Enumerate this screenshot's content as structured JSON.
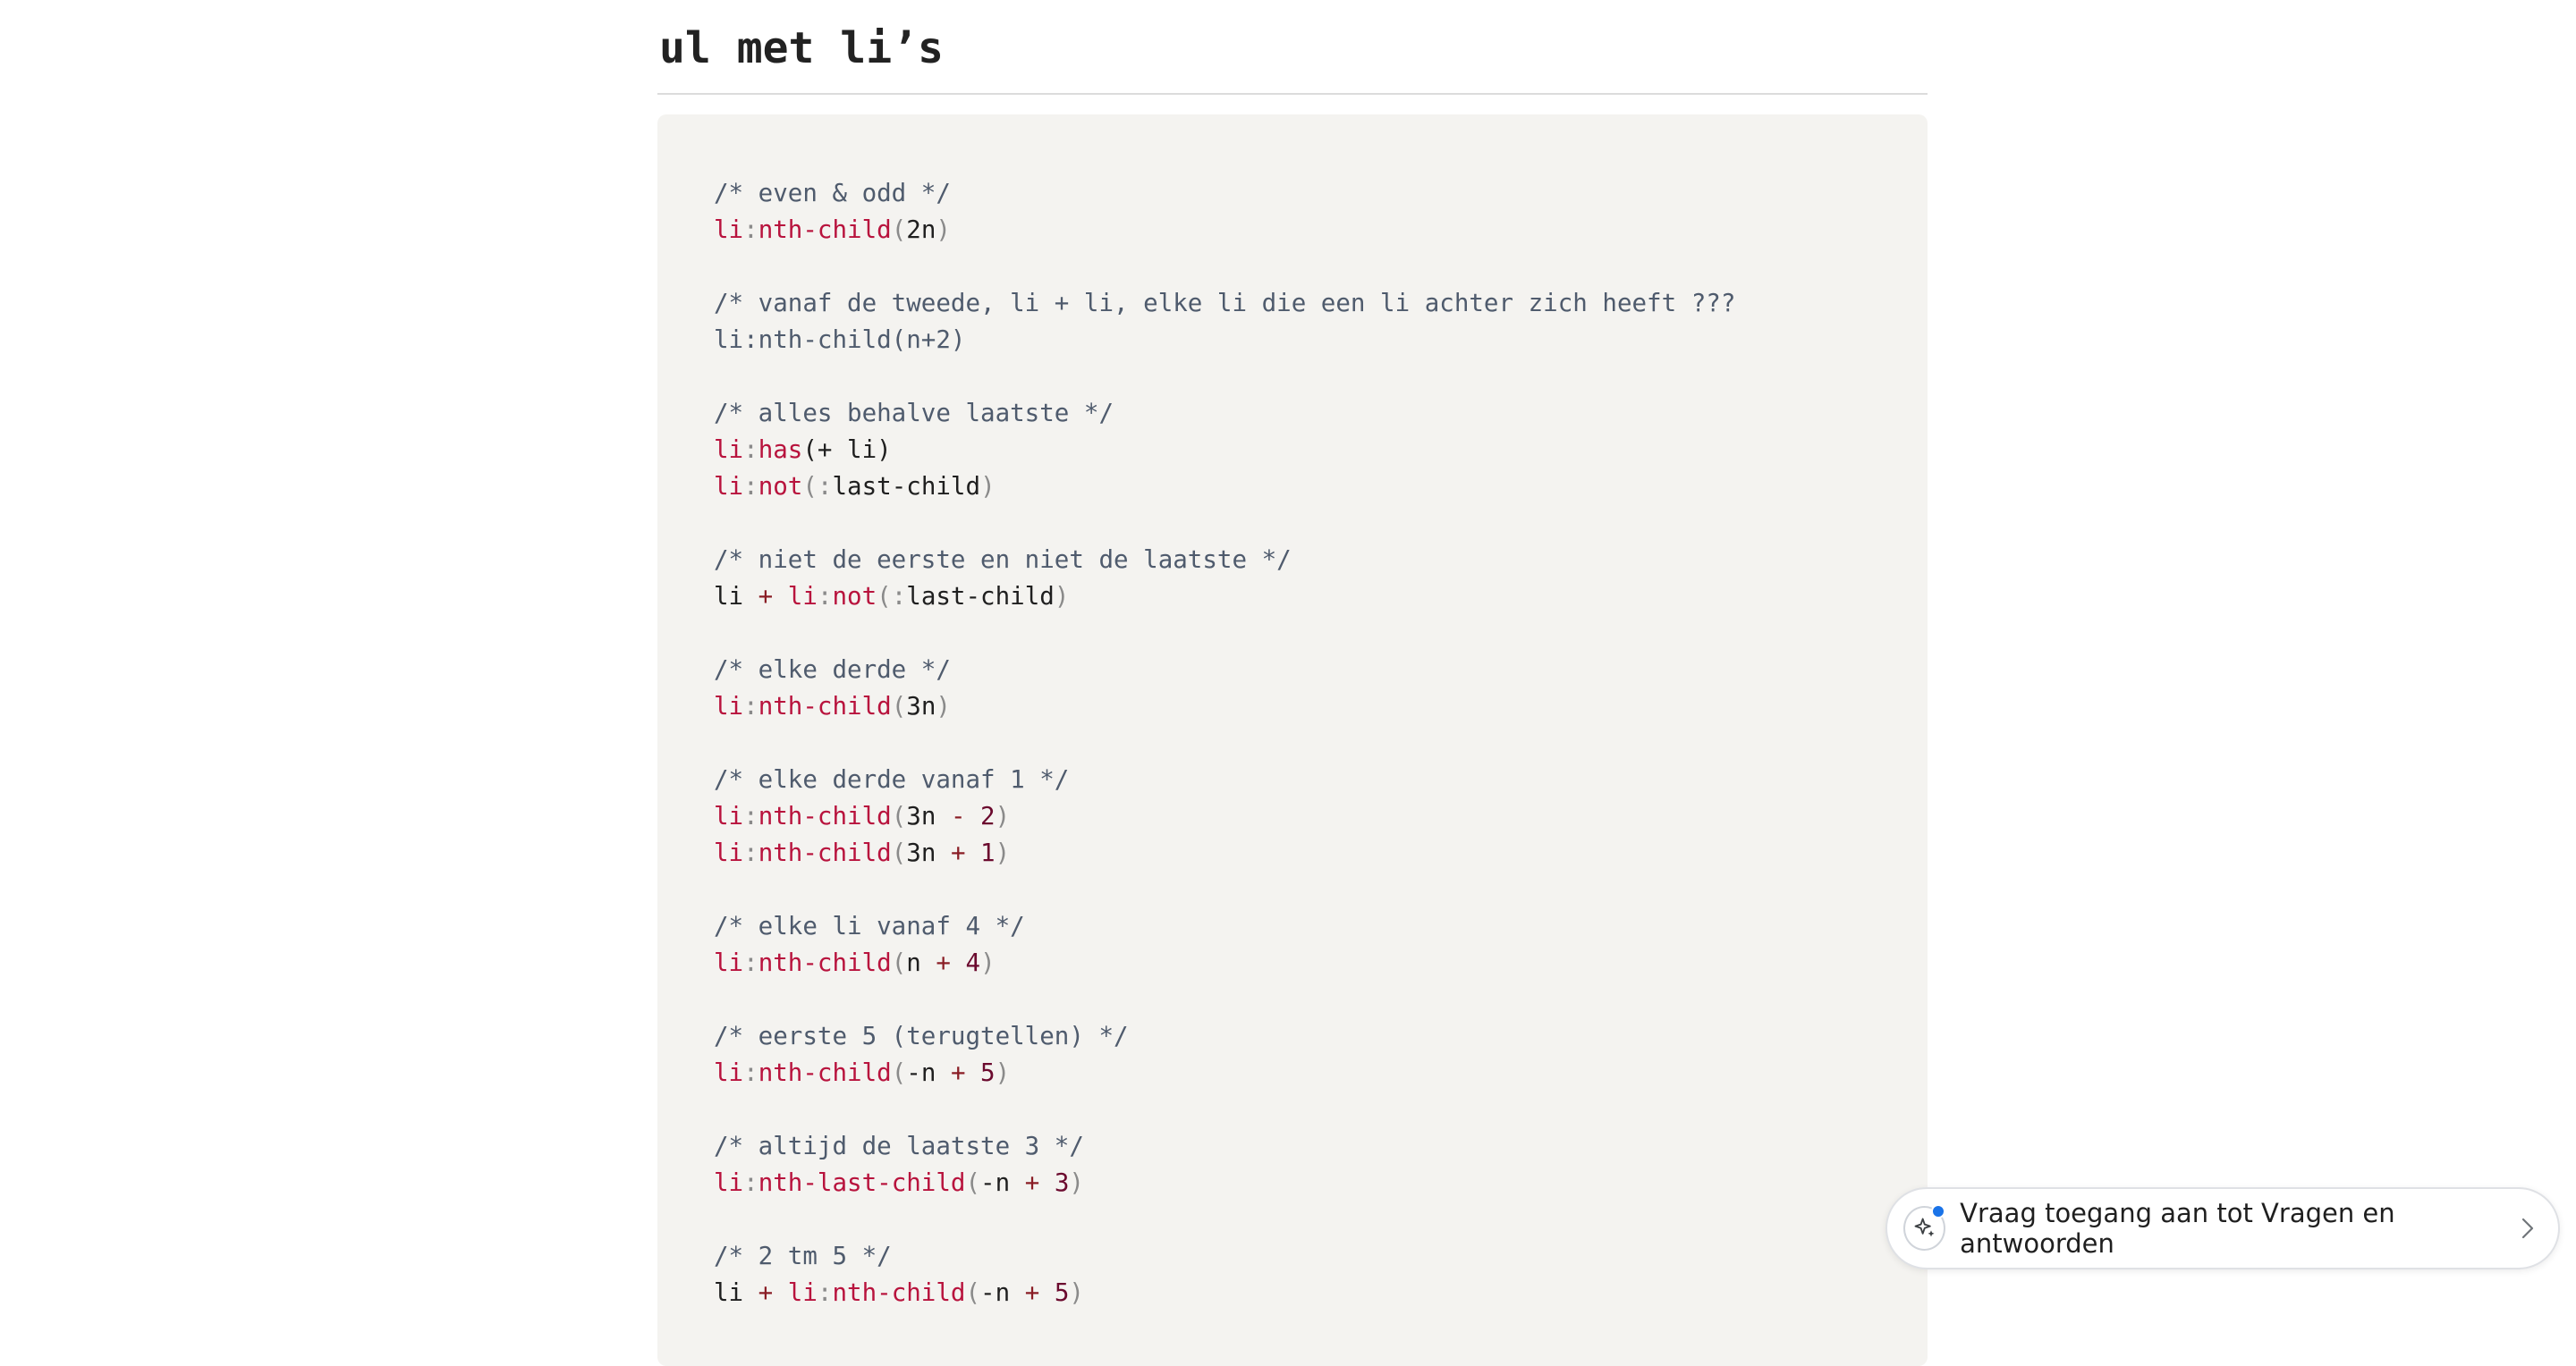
{
  "page": {
    "heading": "ul met li’s"
  },
  "code": {
    "lines": [
      [
        {
          "t": "/* even & odd */",
          "c": "cm"
        }
      ],
      [
        {
          "t": "li",
          "c": "sel"
        },
        {
          "t": ":",
          "c": "pn"
        },
        {
          "t": "nth-child",
          "c": "sel"
        },
        {
          "t": "(",
          "c": "pn"
        },
        {
          "t": "2n",
          "c": "pl"
        },
        {
          "t": ")",
          "c": "pn"
        }
      ],
      [],
      [
        {
          "t": "/* vanaf de tweede, li + li, elke li die een li achter zich heeft ???",
          "c": "cm"
        }
      ],
      [
        {
          "t": "li:nth-child(n+2)",
          "c": "cm"
        }
      ],
      [],
      [
        {
          "t": "/* alles behalve laatste */",
          "c": "cm"
        }
      ],
      [
        {
          "t": "li",
          "c": "sel"
        },
        {
          "t": ":",
          "c": "pn"
        },
        {
          "t": "has",
          "c": "sel"
        },
        {
          "t": "(+ li)",
          "c": "pl"
        }
      ],
      [
        {
          "t": "li",
          "c": "sel"
        },
        {
          "t": ":",
          "c": "pn"
        },
        {
          "t": "not",
          "c": "sel"
        },
        {
          "t": "(",
          "c": "pn"
        },
        {
          "t": ":",
          "c": "pn"
        },
        {
          "t": "last-child",
          "c": "pl"
        },
        {
          "t": ")",
          "c": "pn"
        }
      ],
      [],
      [
        {
          "t": "/* niet de eerste en niet de laatste */",
          "c": "cm"
        }
      ],
      [
        {
          "t": "li ",
          "c": "pl"
        },
        {
          "t": "+",
          "c": "op"
        },
        {
          "t": " li",
          "c": "sel"
        },
        {
          "t": ":",
          "c": "pn"
        },
        {
          "t": "not",
          "c": "sel"
        },
        {
          "t": "(",
          "c": "pn"
        },
        {
          "t": ":",
          "c": "pn"
        },
        {
          "t": "last-child",
          "c": "pl"
        },
        {
          "t": ")",
          "c": "pn"
        }
      ],
      [],
      [
        {
          "t": "/* elke derde */",
          "c": "cm"
        }
      ],
      [
        {
          "t": "li",
          "c": "sel"
        },
        {
          "t": ":",
          "c": "pn"
        },
        {
          "t": "nth-child",
          "c": "sel"
        },
        {
          "t": "(",
          "c": "pn"
        },
        {
          "t": "3n",
          "c": "pl"
        },
        {
          "t": ")",
          "c": "pn"
        }
      ],
      [],
      [
        {
          "t": "/* elke derde vanaf 1 */",
          "c": "cm"
        }
      ],
      [
        {
          "t": "li",
          "c": "sel"
        },
        {
          "t": ":",
          "c": "pn"
        },
        {
          "t": "nth-child",
          "c": "sel"
        },
        {
          "t": "(",
          "c": "pn"
        },
        {
          "t": "3n ",
          "c": "pl"
        },
        {
          "t": "-",
          "c": "op"
        },
        {
          "t": " 2",
          "c": "num"
        },
        {
          "t": ")",
          "c": "pn"
        }
      ],
      [
        {
          "t": "li",
          "c": "sel"
        },
        {
          "t": ":",
          "c": "pn"
        },
        {
          "t": "nth-child",
          "c": "sel"
        },
        {
          "t": "(",
          "c": "pn"
        },
        {
          "t": "3n ",
          "c": "pl"
        },
        {
          "t": "+",
          "c": "op"
        },
        {
          "t": " 1",
          "c": "num"
        },
        {
          "t": ")",
          "c": "pn"
        }
      ],
      [],
      [
        {
          "t": "/* elke li vanaf 4 */",
          "c": "cm"
        }
      ],
      [
        {
          "t": "li",
          "c": "sel"
        },
        {
          "t": ":",
          "c": "pn"
        },
        {
          "t": "nth-child",
          "c": "sel"
        },
        {
          "t": "(",
          "c": "pn"
        },
        {
          "t": "n ",
          "c": "pl"
        },
        {
          "t": "+",
          "c": "op"
        },
        {
          "t": " 4",
          "c": "num"
        },
        {
          "t": ")",
          "c": "pn"
        }
      ],
      [],
      [
        {
          "t": "/* eerste 5 (terugtellen) */",
          "c": "cm"
        }
      ],
      [
        {
          "t": "li",
          "c": "sel"
        },
        {
          "t": ":",
          "c": "pn"
        },
        {
          "t": "nth-child",
          "c": "sel"
        },
        {
          "t": "(",
          "c": "pn"
        },
        {
          "t": "-n ",
          "c": "pl"
        },
        {
          "t": "+",
          "c": "op"
        },
        {
          "t": " 5",
          "c": "num"
        },
        {
          "t": ")",
          "c": "pn"
        }
      ],
      [],
      [
        {
          "t": "/* altijd de laatste 3 */",
          "c": "cm"
        }
      ],
      [
        {
          "t": "li",
          "c": "sel"
        },
        {
          "t": ":",
          "c": "pn"
        },
        {
          "t": "nth-last-child",
          "c": "sel"
        },
        {
          "t": "(",
          "c": "pn"
        },
        {
          "t": "-n ",
          "c": "pl"
        },
        {
          "t": "+",
          "c": "op"
        },
        {
          "t": " 3",
          "c": "num"
        },
        {
          "t": ")",
          "c": "pn"
        }
      ],
      [],
      [
        {
          "t": "/* 2 tm 5 */",
          "c": "cm"
        }
      ],
      [
        {
          "t": "li ",
          "c": "pl"
        },
        {
          "t": "+",
          "c": "op"
        },
        {
          "t": " li",
          "c": "sel"
        },
        {
          "t": ":",
          "c": "pn"
        },
        {
          "t": "nth-child",
          "c": "sel"
        },
        {
          "t": "(",
          "c": "pn"
        },
        {
          "t": "-n ",
          "c": "pl"
        },
        {
          "t": "+",
          "c": "op"
        },
        {
          "t": " 5",
          "c": "num"
        },
        {
          "t": ")",
          "c": "pn"
        }
      ]
    ]
  },
  "toast": {
    "label": "Vraag toegang aan tot Vragen en antwoorden",
    "icon": "sparkle-icon",
    "chevron_icon": "chevron-right-icon",
    "dot_color": "#1a73e8"
  }
}
